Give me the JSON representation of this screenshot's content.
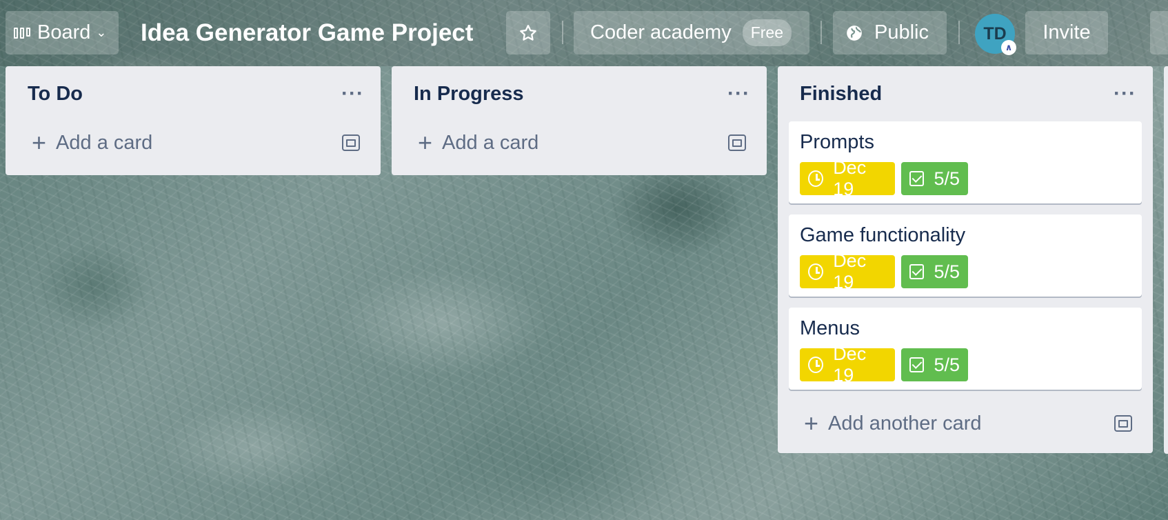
{
  "header": {
    "view_label": "Board",
    "board_title": "Idea Generator Game Project",
    "workspace_name": "Coder academy",
    "workspace_plan": "Free",
    "visibility_label": "Public",
    "member_initials": "TD",
    "invite_label": "Invite"
  },
  "lists": [
    {
      "title": "To Do",
      "add_label": "Add a card"
    },
    {
      "title": "In Progress",
      "add_label": "Add a card"
    },
    {
      "title": "Finished",
      "add_label": "Add another card",
      "cards": [
        {
          "title": "Prompts",
          "due": "Dec 19",
          "checklist": "5/5"
        },
        {
          "title": "Game functionality",
          "due": "Dec 19",
          "checklist": "5/5"
        },
        {
          "title": "Menus",
          "due": "Dec 19",
          "checklist": "5/5"
        }
      ]
    }
  ],
  "colors": {
    "due_complete": "#f2d600",
    "checklist_complete": "#61bd4f",
    "list_bg": "#ebecf0",
    "text_primary": "#172b4d"
  },
  "icons": [
    "board-bars-icon",
    "chevron-down-icon",
    "star-icon",
    "globe-icon",
    "more-icon",
    "plus-icon",
    "template-icon",
    "clock-icon",
    "checklist-icon"
  ]
}
